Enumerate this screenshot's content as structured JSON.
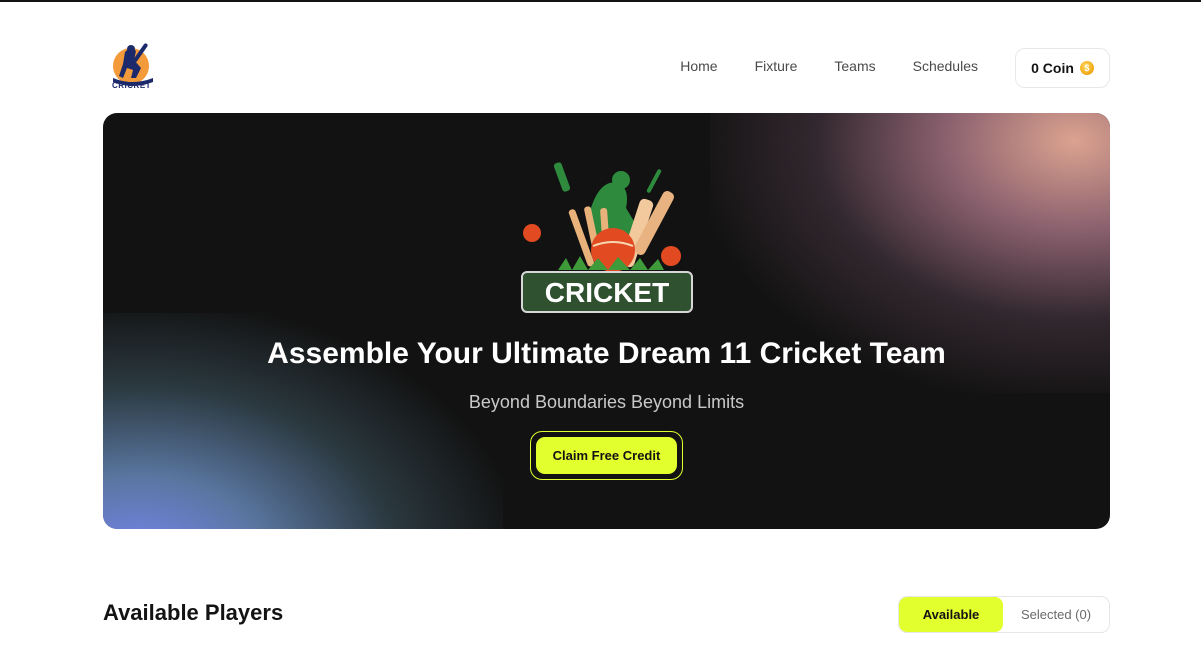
{
  "brand": {
    "logo_text": "CRICKET"
  },
  "nav": {
    "items": [
      "Home",
      "Fixture",
      "Teams",
      "Schedules"
    ]
  },
  "coin": {
    "label": "0 Coin"
  },
  "banner": {
    "art_text": "CRICKET",
    "title": "Assemble Your Ultimate Dream 11 Cricket Team",
    "subtitle": "Beyond Boundaries Beyond Limits",
    "cta_label": "Claim Free Credit"
  },
  "players": {
    "title": "Available Players",
    "toggle": {
      "available_label": "Available",
      "selected_label": "Selected (0)"
    }
  },
  "colors": {
    "accent": "#e2ff2e",
    "dark": "#131313",
    "banner_bg": "#121212"
  }
}
